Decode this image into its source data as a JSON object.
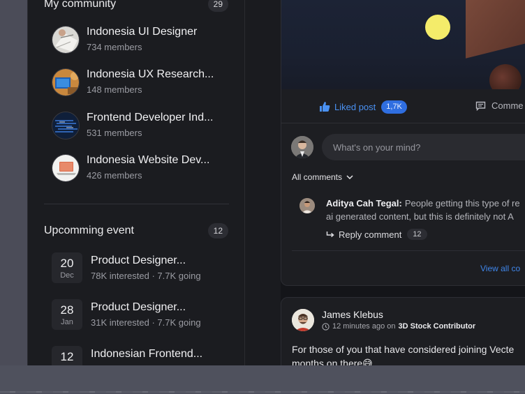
{
  "community": {
    "title": "My community",
    "count": "29",
    "items": [
      {
        "name": "Indonesia UI Designer",
        "members": "734 members"
      },
      {
        "name": "Indonesia UX Research...",
        "members": "148 members"
      },
      {
        "name": "Frontend Developer Ind...",
        "members": "531 members"
      },
      {
        "name": "Indonesia Website Dev...",
        "members": "426 members"
      }
    ]
  },
  "events": {
    "title": "Upcomming event",
    "count": "12",
    "items": [
      {
        "day": "20",
        "month": "Dec",
        "title": "Product Designer...",
        "meta": "78K interested · 7.7K going"
      },
      {
        "day": "28",
        "month": "Jan",
        "title": "Product Designer...",
        "meta": "31K interested · 7.7K going"
      },
      {
        "day": "12",
        "month": "",
        "title": "Indonesian Frontend...",
        "meta": ""
      }
    ]
  },
  "post": {
    "liked_label": "Liked post",
    "like_count": "1,7K",
    "comment_label": "Comme",
    "composer_placeholder": "What's on your mind?",
    "all_comments_label": "All comments",
    "comment": {
      "author": "Aditya Cah Tegal:",
      "line1": "People getting this type of re",
      "line2": "ai generated content, but this is definitely not A",
      "reply_label": "Reply comment",
      "reply_count": "12"
    },
    "view_all_label": "View all co"
  },
  "post2": {
    "author": "James Klebus",
    "time": "12 minutes ago on",
    "channel": "3D Stock Contributor",
    "body_line1": "For those of you that have considered joining Vecte",
    "body_line2": "months on there😅"
  },
  "colors": {
    "accent": "#4a91f2",
    "badge_blue": "#2f6ee0",
    "sidebar_bg": "#1b1c20",
    "card_bg": "#1d1e22"
  }
}
